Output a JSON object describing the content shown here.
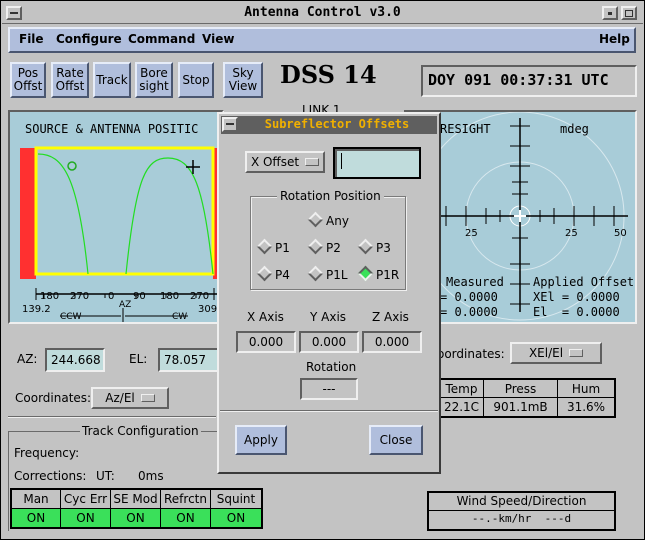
{
  "window": {
    "title": "Antenna Control v3.0"
  },
  "menu": {
    "file": "File",
    "configure": "Configure",
    "command": "Command",
    "view": "View",
    "help": "Help"
  },
  "toolbar": {
    "pos_offst": "Pos\nOffst",
    "rate_offst": "Rate\nOffst",
    "track": "Track",
    "bore_sight": "Bore\nsight",
    "stop": "Stop",
    "sky_view": "Sky\nView"
  },
  "station": "DSS 14",
  "clock": "DOY 091 00:37:31 UTC",
  "link_label": "LINK 1",
  "source_panel": {
    "title": "SOURCE & ANTENNA POSITIC",
    "ticks": [
      "180",
      "270",
      "0",
      "90",
      "180",
      "270"
    ],
    "tick_left": "139.2",
    "tick_right": "309",
    "az_label": "AZ",
    "ccw": "CCW",
    "cw": "CW"
  },
  "boresight_panel": {
    "title": "RESIGHT",
    "units": "mdeg",
    "scale": [
      "25",
      "25",
      "50"
    ],
    "measured_label": "Measured",
    "measured_1": "= 0.0000",
    "measured_2": "= 0.0000",
    "applied_label": "Applied Offset",
    "xel": "XEl = 0.0000",
    "el": "El  = 0.0000"
  },
  "position": {
    "az_label": "AZ:",
    "az_value": "244.668",
    "el_label": "EL:",
    "el_value": "78.057",
    "coord_label": "Coordinates:",
    "coord_value": "Az/El"
  },
  "right_coords": {
    "label": "oordinates:",
    "value": "XEl/El"
  },
  "weather": {
    "headers": [
      "Temp",
      "Press",
      "Hum"
    ],
    "values": [
      "22.1C",
      "901.1mB",
      "31.6%"
    ]
  },
  "wind": {
    "title": "Wind Speed/Direction",
    "value": "--.-km/hr  ---d"
  },
  "track_config": {
    "title": "Track Configuration",
    "frequency_label": "Frequency:",
    "corrections_label": "Corrections:",
    "ut_label": "UT:",
    "ut_value": "0ms",
    "headers": [
      "Man",
      "Cyc Err",
      "SE Mod",
      "Refrctn",
      "Squint"
    ],
    "values": [
      "ON",
      "ON",
      "ON",
      "ON",
      "ON"
    ]
  },
  "dialog": {
    "title": "Subreflector Offsets",
    "axis_select": "X Offset",
    "input_value": "",
    "rotation_group": "Rotation Position",
    "options": [
      "Any",
      "P1",
      "P2",
      "P3",
      "P4",
      "P1L",
      "P1R"
    ],
    "selected": "P1R",
    "x_axis_label": "X Axis",
    "y_axis_label": "Y Axis",
    "z_axis_label": "Z Axis",
    "x_value": "0.000",
    "y_value": "0.000",
    "z_value": "0.000",
    "rotation_label": "Rotation",
    "rotation_value": "---",
    "apply": "Apply",
    "close": "Close"
  },
  "colors": {
    "window_bg": "#c3c3c3",
    "menu_bg": "#b0bedc",
    "plot_bg": "#a8ccd8",
    "trace": "#22dd22",
    "wrap_limit": "#ff3030",
    "status_on": "#3ae05a",
    "dialog_title": "#f0b000"
  }
}
